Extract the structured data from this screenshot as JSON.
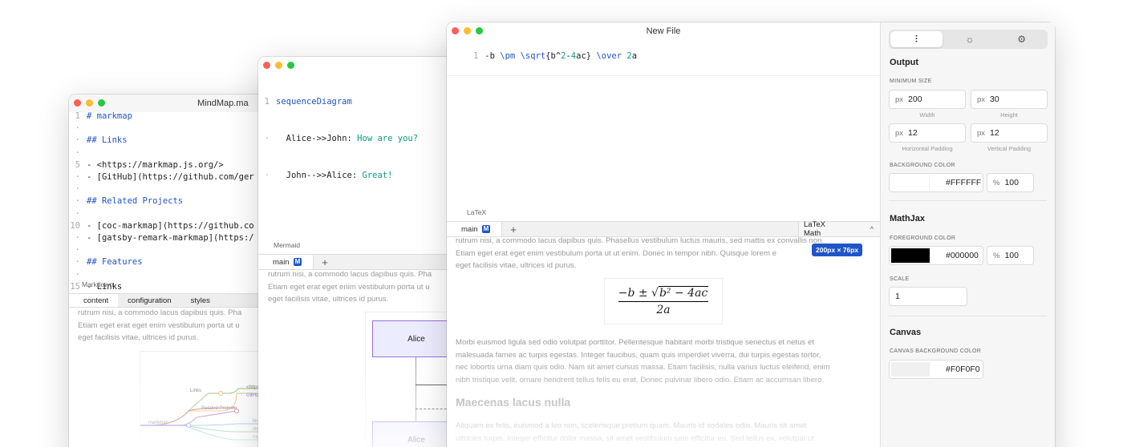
{
  "windows": {
    "mindmap": {
      "title": "MindMap.ma",
      "editor_label": "Markdown",
      "tabs": [
        "content",
        "configuration",
        "styles"
      ],
      "preview_text": [
        "rutrum nisi, a commodo lacus dapibus quis. Pha",
        "Etiam eget erat eget enim vestibulum porta ut u",
        "eget facilisis vitae, ultrices id purus."
      ],
      "map_labels": [
        "Links",
        "<https",
        "GitHu",
        "Related Projects",
        "markmap",
        "lin",
        "str",
        "mu"
      ],
      "code_lines": [
        {
          "n": "1",
          "t": "# markmap"
        },
        {
          "n": "·",
          "t": ""
        },
        {
          "n": "·",
          "t": "## Links"
        },
        {
          "n": "·",
          "t": ""
        },
        {
          "n": "5",
          "t": "- <https://markmap.js.org/>"
        },
        {
          "n": "·",
          "t": "- [GitHub](https://github.com/ger"
        },
        {
          "n": "·",
          "t": ""
        },
        {
          "n": "·",
          "t": "## Related Projects"
        },
        {
          "n": "·",
          "t": ""
        },
        {
          "n": "10",
          "t": "- [coc-markmap](https://github.co"
        },
        {
          "n": "·",
          "t": "- [gatsby-remark-markmap](https:/"
        },
        {
          "n": "·",
          "t": ""
        },
        {
          "n": "·",
          "t": "## Features"
        },
        {
          "n": "·",
          "t": ""
        },
        {
          "n": "15",
          "t": "- Links"
        }
      ]
    },
    "mermaid": {
      "editor_label": "Mermaid",
      "tab_label": "main",
      "tab_badge": "M",
      "code": {
        "n1": "1",
        "keyword": "sequenceDiagram",
        "l2a": "Alice->>John: ",
        "l2b": "How are you?",
        "l3a": "John-->>Alice: ",
        "l3b": "Great!"
      },
      "preview_text": [
        "rutrum nisi, a commodo lacus dapibus quis. Pha",
        "Etiam eget erat eget enim vestibulum porta ut u",
        "eget facilisis vitae, ultrices id purus."
      ],
      "actors": [
        "Alice",
        "Alice"
      ]
    },
    "latex": {
      "title": "New File",
      "line_no": "1",
      "code": {
        "a": "-b ",
        "b": "\\pm ",
        "c": "\\sqrt",
        "d": "{b^",
        "e": "2",
        "f": "-",
        "g": "4",
        "h": "ac} ",
        "i": "\\over ",
        "j": "2",
        "k": "a"
      },
      "editor_label": "LaTeX",
      "tab_label": "main",
      "tab_badge": "M",
      "mode_select": "LaTeX Math",
      "size_badge": "200px × 76px",
      "formula": {
        "num_a": "−b ± ",
        "num_b": "b² − 4ac",
        "den": "2a"
      },
      "preview_text": [
        "rutrum nisi, a commodo lacus dapibus quis. Phasellus vestibulum luctus mauris, sed mattis ex convallis non.",
        "Etiam eget erat eget enim vestibulum porta ut ut enim. Donec in tempor nibh. Quisque lorem e",
        "eget facilisis vitae, ultrices id purus."
      ],
      "preview_text2": [
        "Morbi euismod ligula sed odio volutpat porttitor. Pellentesque habitant morbi tristique senectus et netus et",
        "malesuada fames ac turpis egestas. Integer faucibus, quam quis imperdiet viverra, dui turpis egestas tortor,",
        "nec lobortis urna diam quis odio. Nam sit amet cursus massa. Etiam facilisis, nulla varius luctus eleifend, enim",
        "nibh tristique velit, ornare hendrerit tellus felis eu erat. Donec pulvinar libero odio. Etiam ac accumsan libero."
      ],
      "heading": "Maecenas lacus nulla",
      "preview_text3": [
        "Aliquam ex felis, euismod a leo non, scelerisque pretium quam. Mauris id sodales odio. Mauris sit amet",
        "ultricies turpis. Integer efficitur dolor massa, sit amet vestibulum sem efficitur eu. Sed tellus ex, volutpat ut"
      ]
    }
  },
  "panel": {
    "segments": [
      "sliders-icon",
      "lightbulb-icon",
      "puzzle-icon"
    ],
    "output_title": "Output",
    "min_size_label": "MINIMUM SIZE",
    "unit": "px",
    "width": "200",
    "width_cap": "Width",
    "height": "30",
    "height_cap": "Height",
    "hpad": "12",
    "hpad_cap": "Horizontal Padding",
    "vpad": "12",
    "vpad_cap": "Vertical Padding",
    "bg_label": "BACKGROUND COLOR",
    "bg_hex": "#FFFFFF",
    "pct": "%",
    "bg_alpha": "100",
    "mathjax_title": "MathJax",
    "fg_label": "FOREGROUND COLOR",
    "fg_hex": "#000000",
    "fg_alpha": "100",
    "scale_label": "SCALE",
    "scale": "1",
    "canvas_title": "Canvas",
    "canvas_bg_label": "CANVAS BACKGROUND COLOR",
    "canvas_hex": "#F0F0F0"
  },
  "colors": {
    "accent": "#1f55c9",
    "bg_swatch": "#FFFFFF",
    "fg_swatch": "#000000",
    "canvas_swatch": "#F0F0F0"
  }
}
